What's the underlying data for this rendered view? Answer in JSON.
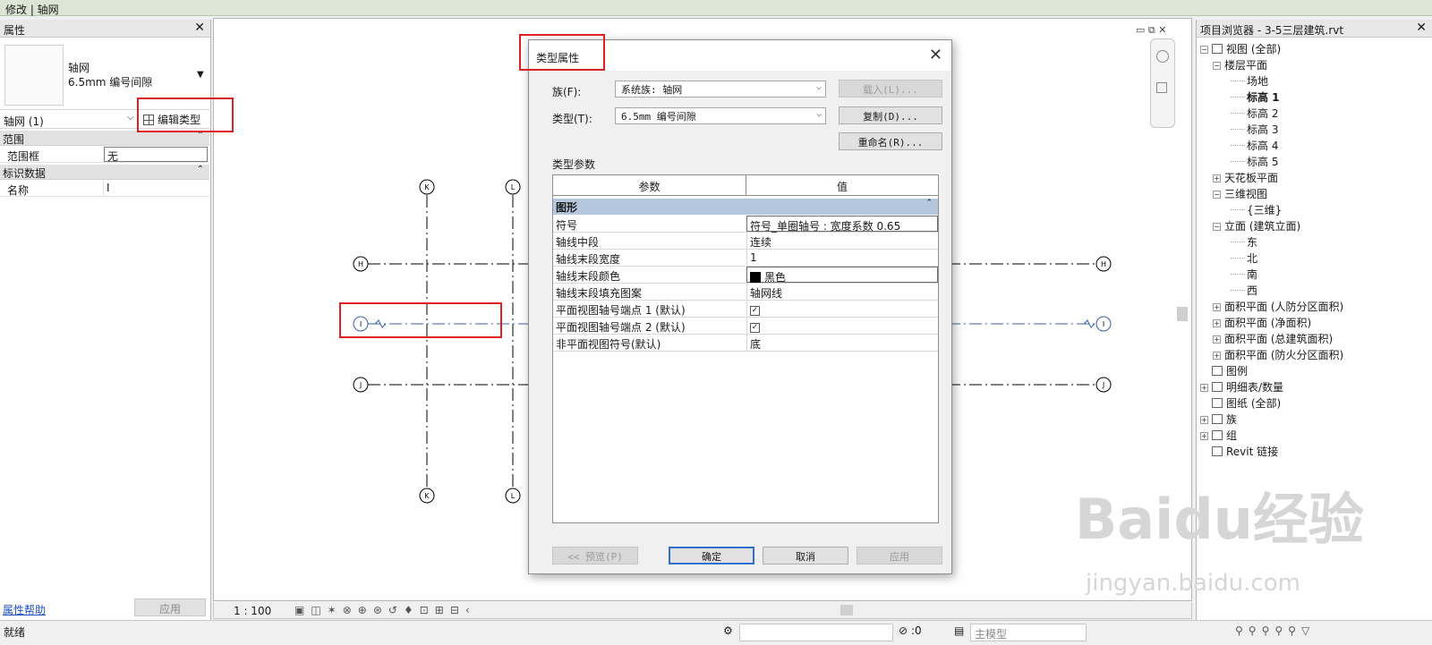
{
  "topbar": {
    "title": "修改 | 轴网"
  },
  "properties": {
    "title": "属性",
    "type_family": "轴网",
    "type_name": "6.5mm 编号间隙",
    "selection": "轴网 (1)",
    "edit_type": "编辑类型",
    "groups": [
      {
        "name": "范围",
        "rows": [
          {
            "key": "范围框",
            "value": "无"
          }
        ]
      },
      {
        "name": "标识数据",
        "rows": [
          {
            "key": "名称",
            "value": "I"
          }
        ]
      }
    ],
    "help": "属性帮助",
    "apply": "应用"
  },
  "canvas": {
    "grid_labels": {
      "K": "K",
      "L": "L",
      "H": "H",
      "I": "I",
      "J": "J"
    }
  },
  "viewbar": {
    "scale": "1 : 100"
  },
  "browser": {
    "title": "项目浏览器 - 3-5三层建筑.rvt",
    "nodes": [
      {
        "label": "视图 (全部)",
        "level": 0,
        "toggle": "−",
        "icon": "views-icon"
      },
      {
        "label": "楼层平面",
        "level": 1,
        "toggle": "−"
      },
      {
        "label": "场地",
        "level": 2
      },
      {
        "label": "标高 1",
        "level": 2,
        "bold": true
      },
      {
        "label": "标高 2",
        "level": 2
      },
      {
        "label": "标高 3",
        "level": 2
      },
      {
        "label": "标高 4",
        "level": 2
      },
      {
        "label": "标高 5",
        "level": 2
      },
      {
        "label": "天花板平面",
        "level": 1,
        "toggle": "+"
      },
      {
        "label": "三维视图",
        "level": 1,
        "toggle": "−"
      },
      {
        "label": "{三维}",
        "level": 2
      },
      {
        "label": "立面 (建筑立面)",
        "level": 1,
        "toggle": "−"
      },
      {
        "label": "东",
        "level": 2
      },
      {
        "label": "北",
        "level": 2
      },
      {
        "label": "南",
        "level": 2
      },
      {
        "label": "西",
        "level": 2
      },
      {
        "label": "面积平面 (人防分区面积)",
        "level": 1,
        "toggle": "+"
      },
      {
        "label": "面积平面 (净面积)",
        "level": 1,
        "toggle": "+"
      },
      {
        "label": "面积平面 (总建筑面积)",
        "level": 1,
        "toggle": "+"
      },
      {
        "label": "面积平面 (防火分区面积)",
        "level": 1,
        "toggle": "+"
      },
      {
        "label": "图例",
        "level": 0,
        "icon": "legend-icon"
      },
      {
        "label": "明细表/数量",
        "level": 0,
        "toggle": "+",
        "icon": "schedule-icon"
      },
      {
        "label": "图纸 (全部)",
        "level": 0,
        "icon": "sheets-icon"
      },
      {
        "label": "族",
        "level": 0,
        "toggle": "+",
        "icon": "families-icon"
      },
      {
        "label": "组",
        "level": 0,
        "toggle": "+",
        "icon": "groups-icon"
      },
      {
        "label": "Revit 链接",
        "level": 0,
        "icon": "link-icon"
      }
    ]
  },
  "status": {
    "text": "就绪",
    "selection_count": ":0",
    "model": "主模型"
  },
  "dialog": {
    "title": "类型属性",
    "family_label": "族(F):",
    "family_value": "系统族: 轴网",
    "type_label": "类型(T):",
    "type_value": "6.5mm 编号间隙",
    "load_btn": "载入(L)...",
    "duplicate_btn": "复制(D)...",
    "rename_btn": "重命名(R)...",
    "params_label": "类型参数",
    "col_param": "参数",
    "col_value": "值",
    "group": "图形",
    "rows": [
      {
        "key": "符号",
        "value": "符号_单圈轴号 : 宽度系数 0.65"
      },
      {
        "key": "轴线中段",
        "value": "连续"
      },
      {
        "key": "轴线末段宽度",
        "value": "1"
      },
      {
        "key": "轴线末段颜色",
        "value": "黑色"
      },
      {
        "key": "轴线末段填充图案",
        "value": "轴网线"
      },
      {
        "key": "平面视图轴号端点 1 (默认)",
        "value": "☑"
      },
      {
        "key": "平面视图轴号端点 2 (默认)",
        "value": "☑"
      },
      {
        "key": "非平面视图符号(默认)",
        "value": "底"
      }
    ],
    "preview_btn": "<< 预览(P)",
    "ok_btn": "确定",
    "cancel_btn": "取消",
    "apply_btn": "应用"
  },
  "watermark": {
    "brand": "Baidu经验",
    "url": "jingyan.baidu.com"
  },
  "colors": {
    "accent": "#2f6fd0",
    "annotation": "#e02020",
    "grid_line": "#000000",
    "selected_grid": "#3a5fa8"
  }
}
